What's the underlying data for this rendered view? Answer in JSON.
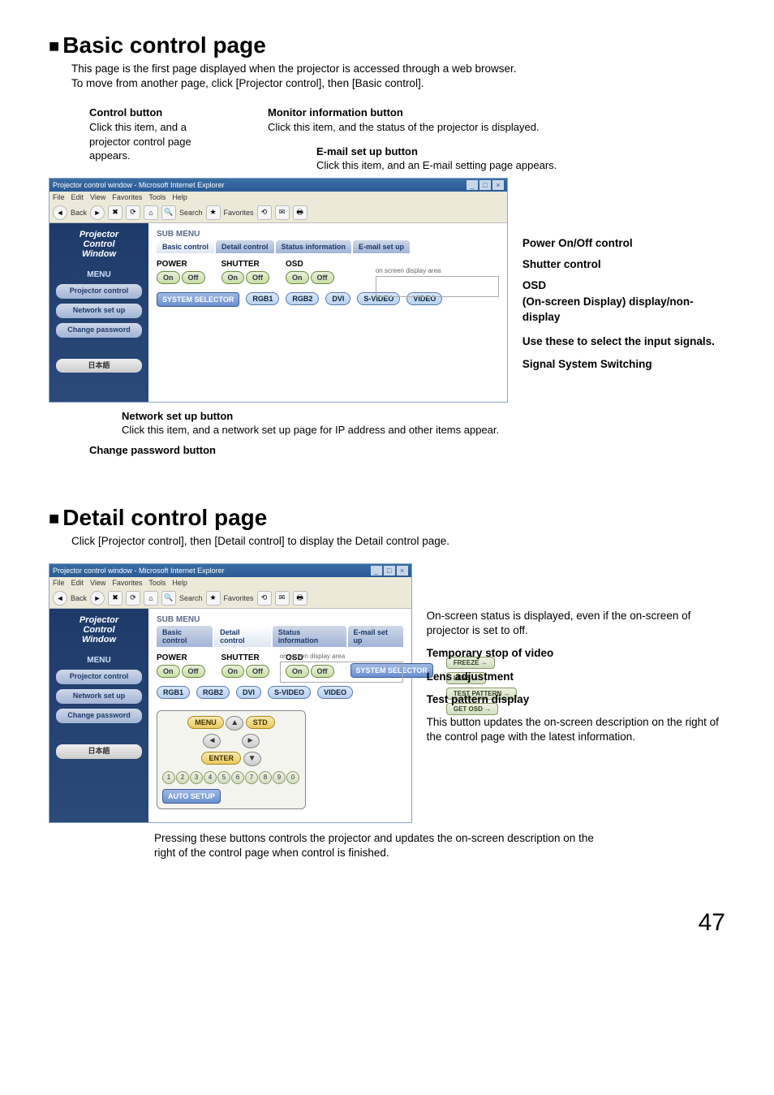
{
  "page_number": "47",
  "basic": {
    "heading": "Basic control page",
    "intro_line1": "This page is the first page displayed when the projector is accessed through a web browser.",
    "intro_line2": "To move from another page, click [Projector control], then [Basic control].",
    "captions": {
      "control_button_title": "Control button",
      "control_button_desc1": "Click this item, and a",
      "control_button_desc2": "projector control page",
      "control_button_desc3": "appears.",
      "monitor_title": "Monitor information button",
      "monitor_desc": "Click this item, and the status of the projector is displayed.",
      "email_title": "E-mail set up button",
      "email_desc": "Click this item, and an E-mail setting page appears."
    },
    "annotations": {
      "power": "Power On/Off control",
      "shutter": "Shutter control",
      "osd_head": "OSD",
      "osd_desc": "(On-screen Display) display/non-display",
      "input_sel": "Use these to select the input signals.",
      "sig_switch": "Signal System Switching"
    },
    "bottom": {
      "net_title": "Network set up button",
      "net_desc": "Click this item, and a network set up page for IP address and other items appear.",
      "chpw": "Change password button"
    }
  },
  "detail": {
    "heading": "Detail control page",
    "intro": "Click [Projector control], then [Detail control] to display the Detail control page.",
    "annotations": {
      "osd_status": "On-screen status is displayed, even if the on-screen of projector is set to off.",
      "temp_stop": "Temporary stop of video",
      "lens": "Lens adjustment",
      "test": "Test pattern display",
      "getosd": "This button updates the on-screen description on the right of the control page with the latest information."
    },
    "below": "Pressing these buttons controls the projector and updates the on-screen description on the right of the control page when control is finished."
  },
  "browser": {
    "title": "Projector control window - Microsoft Internet Explorer",
    "menus": [
      "File",
      "Edit",
      "View",
      "Favorites",
      "Tools",
      "Help"
    ],
    "toolbar": {
      "back": "Back",
      "search": "Search",
      "favorites": "Favorites"
    }
  },
  "app": {
    "logo1": "Projector",
    "logo2": "Control",
    "logo3": "Window",
    "menu_head": "MENU",
    "side": {
      "projector_control": "Projector control",
      "network_setup": "Network set up",
      "change_password": "Change password",
      "japanese": "日本語"
    },
    "submenu": "SUB MENU",
    "tabs": {
      "basic": "Basic control",
      "detail": "Detail control",
      "status": "Status information",
      "email": "E-mail set up"
    },
    "groups": {
      "power": "POWER",
      "shutter": "SHUTTER",
      "osd": "OSD",
      "on": "On",
      "off": "Off",
      "system_selector": "SYSTEM SELECTOR",
      "rgb1": "RGB1",
      "rgb2": "RGB2",
      "dvi": "DVI",
      "svideo": "S-VIDEO",
      "video": "VIDEO",
      "freeze": "FREEZE",
      "lens": "LENS",
      "test_pattern": "TEST PATTERN",
      "get_osd": "GET OSD",
      "menu": "MENU",
      "std": "STD",
      "enter": "ENTER",
      "auto_setup": "AUTO SETUP"
    },
    "osd_area_label": "on screen display area"
  }
}
